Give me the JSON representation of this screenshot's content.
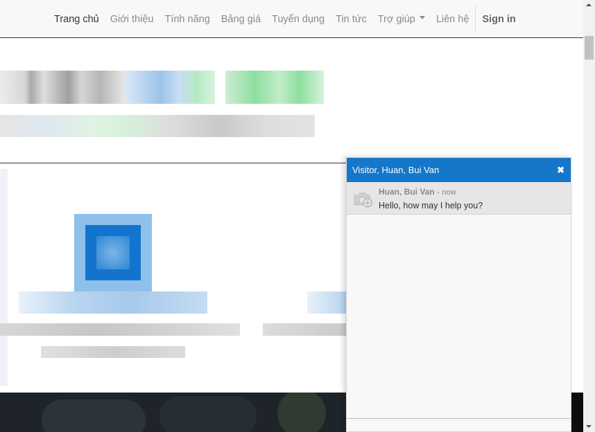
{
  "navbar": {
    "items": [
      {
        "label": "Trang chủ",
        "active": true
      },
      {
        "label": "Giới thiệu"
      },
      {
        "label": "Tính năng"
      },
      {
        "label": "Bảng giá"
      },
      {
        "label": "Tuyển dụng"
      },
      {
        "label": "Tin tức"
      },
      {
        "label": "Trợ giúp",
        "dropdown": true
      },
      {
        "label": "Liên hệ"
      }
    ],
    "signin_label": "Sign in"
  },
  "chat": {
    "title": "Visitor, Huan, Bui Van",
    "close_icon": "close-icon",
    "messages": [
      {
        "sender": "Huan, Bui Van",
        "separator": " - ",
        "time": "now",
        "text": "Hello, how may I help you?",
        "avatar_icon": "camera-add-icon"
      }
    ]
  },
  "colors": {
    "chat_header": "#1577c9",
    "navbar_bg": "#f8f8f8",
    "message_bg": "#e6e6e6"
  }
}
